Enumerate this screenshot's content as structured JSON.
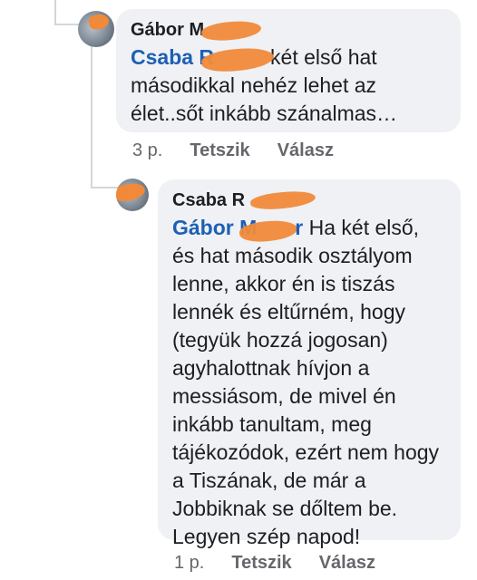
{
  "comments": [
    {
      "author": "Gábor M",
      "mention": "Csaba R",
      "text": "két első hat másodikkal nehéz lehet az élet..sőt inkább szánalmas…",
      "time": "3 p.",
      "like_label": "Tetszik",
      "reply_label": "Válasz"
    },
    {
      "author": "Csaba R",
      "mention": "Gábor M",
      "mention_tail": "r",
      "text": "Ha két első, és hat második osztályom lenne, akkor én is tiszás lennék és eltűrném, hogy (tegyük hozzá jogosan) agyhalottnak hívjon a messiásom, de mivel én inkább tanultam, meg tájékozódok, ezért nem hogy a Tiszának, de már a Jobbiknak se dőltem be. Legyen szép napod!",
      "time": "1 p.",
      "like_label": "Tetszik",
      "reply_label": "Válasz"
    }
  ],
  "colors": {
    "bubble": "#eff1f4",
    "mention": "#1d5fb5",
    "meta": "#65676b",
    "redaction": "#f08a3a"
  }
}
